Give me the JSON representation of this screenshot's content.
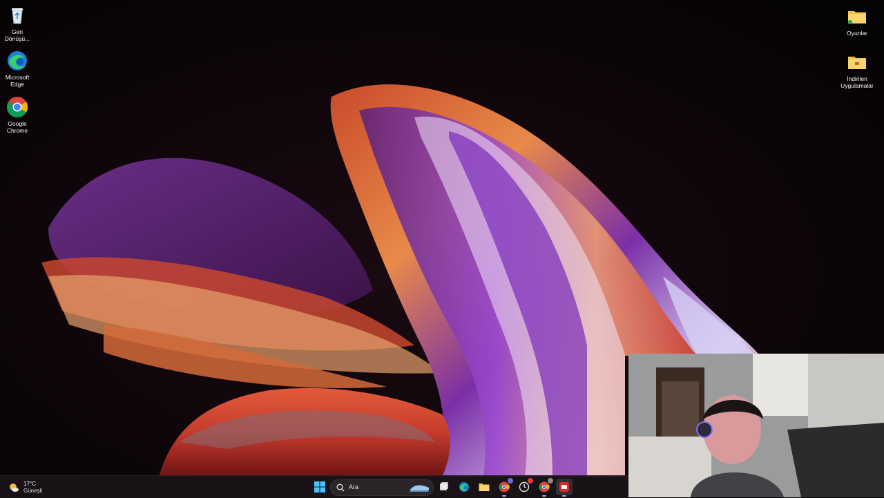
{
  "desktop": {
    "left_icons": [
      {
        "label": "Geri\nDönüşü...",
        "icon": "recycle-bin-icon"
      },
      {
        "label": "Microsoft\nEdge",
        "icon": "edge-icon"
      },
      {
        "label": "Google\nChrome",
        "icon": "chrome-icon"
      }
    ],
    "right_icons": [
      {
        "label": "Oyunlar",
        "icon": "folder-icon"
      },
      {
        "label": "İndirilen\nUygulamalar",
        "icon": "folder-icon"
      }
    ]
  },
  "taskbar": {
    "weather": {
      "temp": "17°C",
      "condition": "Güneşli",
      "icon": "sun-cloud-icon"
    },
    "search": {
      "placeholder": "Ara",
      "icon": "search-icon"
    },
    "apps": [
      {
        "name": "start-button",
        "icon": "windows-icon"
      },
      {
        "name": "task-view",
        "icon": "task-view-icon"
      },
      {
        "name": "edge",
        "icon": "edge-icon"
      },
      {
        "name": "file-explorer",
        "icon": "folder-icon"
      },
      {
        "name": "chrome-profile-1",
        "icon": "chrome-icon"
      },
      {
        "name": "clock-app",
        "icon": "clock-icon"
      },
      {
        "name": "chrome-profile-2",
        "icon": "chrome-icon"
      },
      {
        "name": "recording-app",
        "icon": "red-app-icon"
      }
    ],
    "accent": "#9aa6ff"
  },
  "webcam": {
    "visible": true
  }
}
